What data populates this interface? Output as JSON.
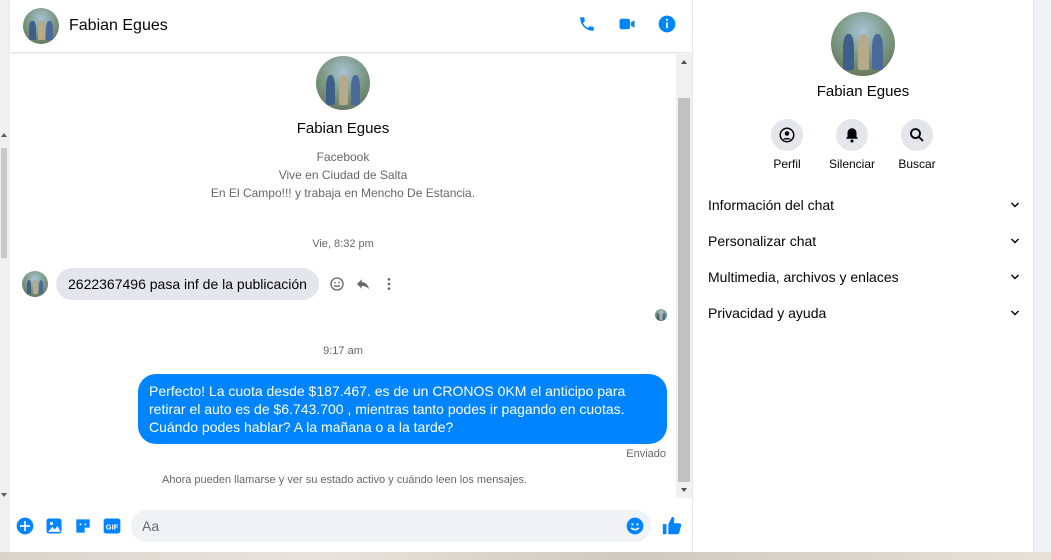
{
  "header": {
    "name": "Fabian Egues",
    "icons": [
      "phone-icon",
      "video-icon",
      "info-icon"
    ]
  },
  "profile": {
    "name": "Fabian Egues",
    "lines": [
      "Facebook",
      "Vive en Ciudad de Salta",
      "En El Campo!!! y trabaja en Mencho De Estancia."
    ]
  },
  "messages": {
    "timestamp1": "Vie, 8:32 pm",
    "received": "2622367496 pasa inf de la publicación",
    "timestamp2": "9:17 am",
    "sent": "Perfecto! La cuota desde $187.467. es de un CRONOS 0KM el anticipo para retirar el auto es de $6.743.700 , mientras tanto podes ir pagando en cuotas. Cuándo podes hablar? A la mañana o a la tarde?",
    "sent_status": "Enviado",
    "notice": "Ahora pueden llamarse y ver su estado activo y cuándo leen los mensajes."
  },
  "composer": {
    "placeholder": "Aa",
    "gif_label": "GIF"
  },
  "right_panel": {
    "name": "Fabian Egues",
    "actions": [
      {
        "label": "Perfil"
      },
      {
        "label": "Silenciar"
      },
      {
        "label": "Buscar"
      }
    ],
    "sections": [
      {
        "label": "Información del chat"
      },
      {
        "label": "Personalizar chat"
      },
      {
        "label": "Multimedia, archivos y enlaces"
      },
      {
        "label": "Privacidad y ayuda"
      }
    ]
  },
  "colors": {
    "accent": "#0084ff",
    "received_bubble": "#e4e6eb",
    "secondary_text": "#65676b"
  }
}
